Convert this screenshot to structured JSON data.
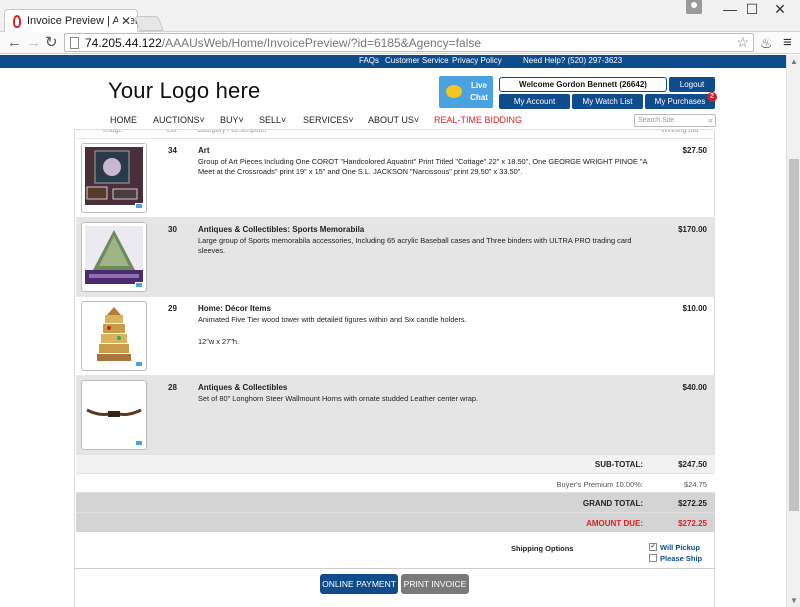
{
  "browser": {
    "tab_title": "Invoice Preview | American",
    "url_host": "74.205.44.122",
    "url_path": "/AAAUsWeb/Home/InvoicePreview/?id=6185&Agency=false",
    "controls": {
      "minimize": "—",
      "maximize": "☐",
      "close": "✕"
    }
  },
  "topbar": {
    "faqs": "FAQs",
    "customer_service": "Customer Service",
    "privacy": "Privacy Policy",
    "help": "Need Help? (520) 297-3623"
  },
  "header": {
    "logo": "Your Logo here",
    "live_chat": "Live Chat",
    "welcome": "Welcome Gordon Bennett (26642)",
    "logout": "Logout",
    "my_account": "My Account",
    "watch_list": "My Watch List",
    "purchases": "My Purchases",
    "purchases_badge": "2"
  },
  "nav": {
    "home": "HOME",
    "auctions": "AUCTIONS",
    "buy": "BUY",
    "sell": "SELL",
    "services": "SERVICES",
    "about": "ABOUT US",
    "realtime": "REAL-TIME BIDDING",
    "search_placeholder": "Search Site"
  },
  "columns": {
    "image": "Image",
    "lot": "Lot",
    "category": "Category / Description",
    "bid": "Winning Bid"
  },
  "items": [
    {
      "lot": "34",
      "category": "Art",
      "desc": "Group of Art Pieces Including One COROT \"Handcolored Aquatint\" Print Titled \"Cottage\" 22\" x 18.50\", One GEORGE WRIGHT PINOE \"A Meet at the Crossroads\" print 19\" x 15\" and One S.L. JACKSON \"Narcissous\" print 29.50\" x 33.50\".",
      "desc2": "",
      "price": "$27.50"
    },
    {
      "lot": "30",
      "category": "Antiques & Collectibles: Sports Memorabila",
      "desc": "Large group of Sports memorabila accessories, Including 65 acrylic Baseball cases and Three binders with ULTRA PRO trading card sleeves.",
      "desc2": "",
      "price": "$170.00"
    },
    {
      "lot": "29",
      "category": "Home: Décor Items",
      "desc": "Animated Five Tier wood tower with detailed figures within and Six candle holders.",
      "desc2": "12\"w x 27\"h.",
      "price": "$10.00"
    },
    {
      "lot": "28",
      "category": "Antiques & Collectibles",
      "desc": "Set of 80\" Longhorn Steer Wallmount Horns with ornate studded Leather center wrap.",
      "desc2": "",
      "price": "$40.00"
    }
  ],
  "summary": {
    "subtotal_label": "SUB-TOTAL:",
    "subtotal": "$247.50",
    "premium_label": "Buyer's Premium 10.00%:",
    "premium": "$24.75",
    "grand_label": "GRAND TOTAL:",
    "grand": "$272.25",
    "due_label": "AMOUNT DUE:",
    "due": "$272.25"
  },
  "shipping": {
    "label": "Shipping Options",
    "pickup": "Will Pickup",
    "ship": "Please Ship",
    "pickup_checked": true,
    "ship_checked": false
  },
  "actions": {
    "online_payment": "ONLINE PAYMENT",
    "print_invoice": "PRINT INVOICE"
  },
  "colors": {
    "brand_blue": "#0f4c8c",
    "accent_red": "#d22222",
    "chat_blue": "#4aa3e0",
    "button_gray": "#7a7a7a"
  }
}
